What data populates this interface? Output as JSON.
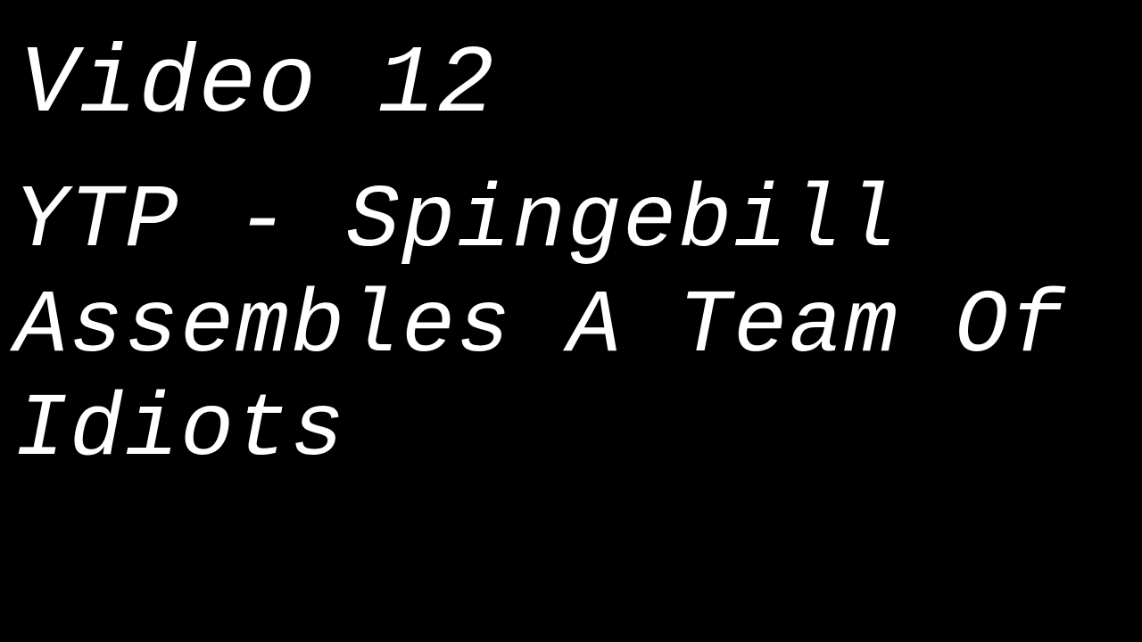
{
  "heading": "Video 12",
  "title_lines": [
    "YTP - Spingebill",
    "Assembles A Team Of",
    "Idiots"
  ],
  "colors": {
    "background": "#000000",
    "text": "#ffffff"
  }
}
